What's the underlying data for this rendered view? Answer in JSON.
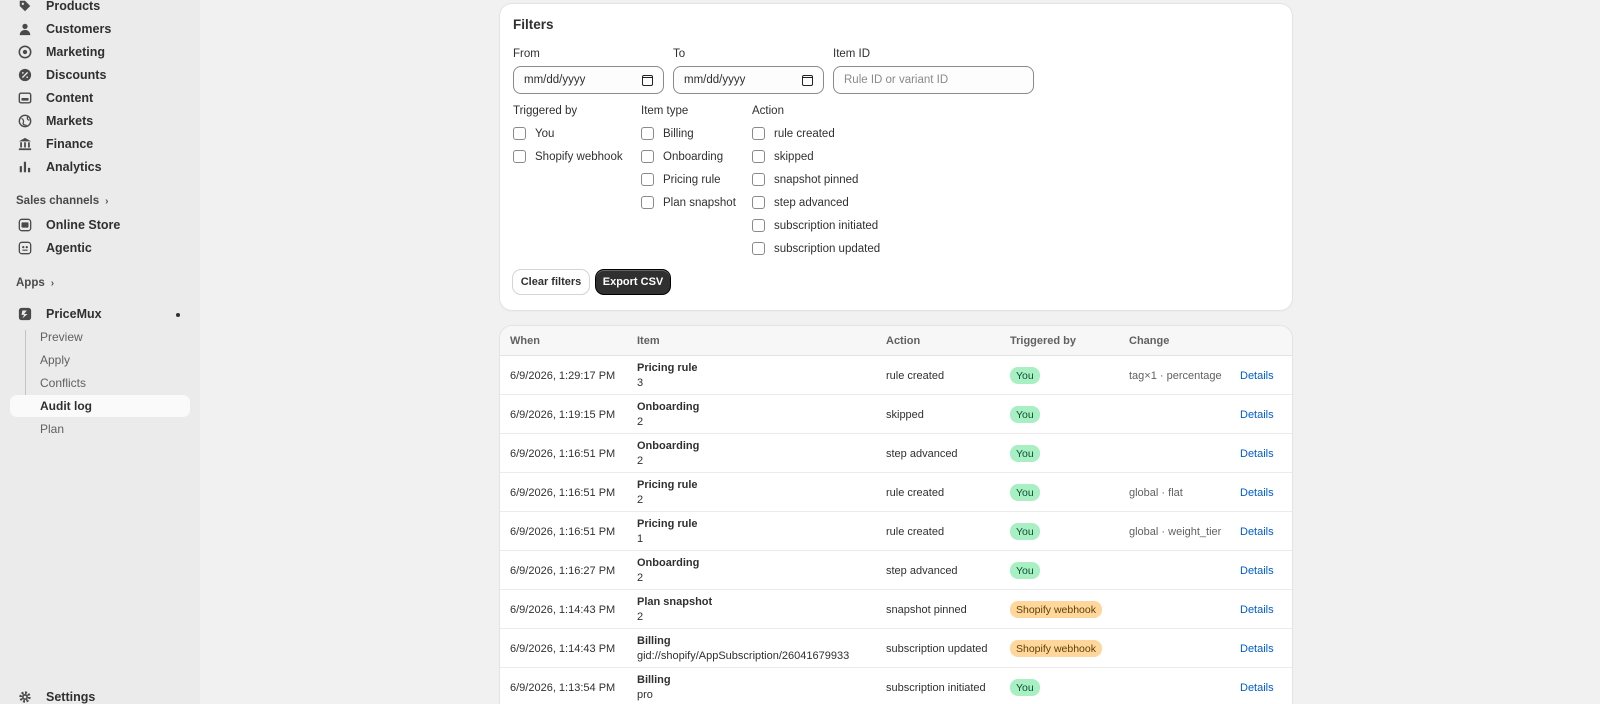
{
  "sidebar": {
    "nav": [
      {
        "label": "Products",
        "icon": "tag-icon"
      },
      {
        "label": "Customers",
        "icon": "person-icon"
      },
      {
        "label": "Marketing",
        "icon": "target-icon"
      },
      {
        "label": "Discounts",
        "icon": "discount-icon"
      },
      {
        "label": "Content",
        "icon": "content-icon"
      },
      {
        "label": "Markets",
        "icon": "globe-icon"
      },
      {
        "label": "Finance",
        "icon": "bank-icon"
      },
      {
        "label": "Analytics",
        "icon": "bar-chart-icon"
      }
    ],
    "sales_channels": {
      "heading": "Sales channels",
      "items": [
        {
          "label": "Online Store",
          "icon": "store-icon"
        },
        {
          "label": "Agentic",
          "icon": "agentic-icon"
        }
      ]
    },
    "apps": {
      "heading": "Apps",
      "app_name": "PriceMux",
      "sub_items": [
        "Preview",
        "Apply",
        "Conflicts",
        "Audit log",
        "Plan"
      ],
      "active": "Audit log"
    },
    "settings_label": "Settings"
  },
  "filters": {
    "title": "Filters",
    "from_label": "From",
    "from_value": "mm/dd/yyyy",
    "to_label": "To",
    "to_value": "mm/dd/yyyy",
    "item_id_label": "Item ID",
    "item_id_placeholder": "Rule ID or variant ID",
    "triggered_by": {
      "label": "Triggered by",
      "options": [
        "You",
        "Shopify webhook"
      ]
    },
    "item_type": {
      "label": "Item type",
      "options": [
        "Billing",
        "Onboarding",
        "Pricing rule",
        "Plan snapshot"
      ]
    },
    "action": {
      "label": "Action",
      "options": [
        "rule created",
        "skipped",
        "snapshot pinned",
        "step advanced",
        "subscription initiated",
        "subscription updated"
      ]
    },
    "clear_label": "Clear filters",
    "export_label": "Export CSV"
  },
  "table": {
    "headers": {
      "when": "When",
      "item": "Item",
      "action": "Action",
      "triggered_by": "Triggered by",
      "change": "Change"
    },
    "details_label": "Details",
    "rows": [
      {
        "when": "6/9/2026, 1:29:17 PM",
        "item": "Pricing rule",
        "item_sub": "3",
        "action": "rule created",
        "triggered_by": "You",
        "change": "tag×1 · percentage"
      },
      {
        "when": "6/9/2026, 1:19:15 PM",
        "item": "Onboarding",
        "item_sub": "2",
        "action": "skipped",
        "triggered_by": "You",
        "change": ""
      },
      {
        "when": "6/9/2026, 1:16:51 PM",
        "item": "Onboarding",
        "item_sub": "2",
        "action": "step advanced",
        "triggered_by": "You",
        "change": ""
      },
      {
        "when": "6/9/2026, 1:16:51 PM",
        "item": "Pricing rule",
        "item_sub": "2",
        "action": "rule created",
        "triggered_by": "You",
        "change": "global · flat"
      },
      {
        "when": "6/9/2026, 1:16:51 PM",
        "item": "Pricing rule",
        "item_sub": "1",
        "action": "rule created",
        "triggered_by": "You",
        "change": "global · weight_tier"
      },
      {
        "when": "6/9/2026, 1:16:27 PM",
        "item": "Onboarding",
        "item_sub": "2",
        "action": "step advanced",
        "triggered_by": "You",
        "change": ""
      },
      {
        "when": "6/9/2026, 1:14:43 PM",
        "item": "Plan snapshot",
        "item_sub": "2",
        "action": "snapshot pinned",
        "triggered_by": "Shopify webhook",
        "change": ""
      },
      {
        "when": "6/9/2026, 1:14:43 PM",
        "item": "Billing",
        "item_sub": "gid://shopify/AppSubscription/26041679933",
        "action": "subscription updated",
        "triggered_by": "Shopify webhook",
        "change": ""
      },
      {
        "when": "6/9/2026, 1:13:54 PM",
        "item": "Billing",
        "item_sub": "pro",
        "action": "subscription initiated",
        "triggered_by": "You",
        "change": ""
      }
    ]
  }
}
